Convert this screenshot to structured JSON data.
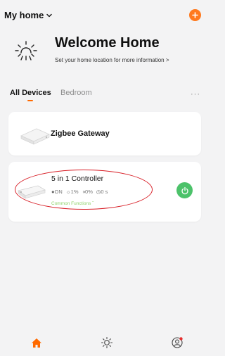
{
  "header": {
    "home_name": "My home",
    "add_icon": "plus-icon",
    "accent_color": "#ff7a1f"
  },
  "welcome": {
    "title": "Welcome Home",
    "subtitle": "Set your home location for more information  >"
  },
  "tabs": [
    {
      "label": "All Devices",
      "active": true
    },
    {
      "label": "Bedroom",
      "active": false
    }
  ],
  "more_icon": "more-horizontal-icon",
  "devices": [
    {
      "name": "Zigbee Gateway",
      "icon": "zigbee-gateway-image"
    },
    {
      "name": "5 in 1 Controller",
      "icon": "controller-image",
      "status": {
        "power": "ON",
        "brightness": "1%",
        "temperature": "0%",
        "timer": "0 s"
      },
      "common_functions": "Common Functions",
      "power_color": "#4cc26a"
    }
  ],
  "bottom_nav": [
    {
      "icon": "home-icon",
      "active": true
    },
    {
      "icon": "scene-sun-icon",
      "active": false
    },
    {
      "icon": "profile-icon",
      "active": false
    }
  ]
}
